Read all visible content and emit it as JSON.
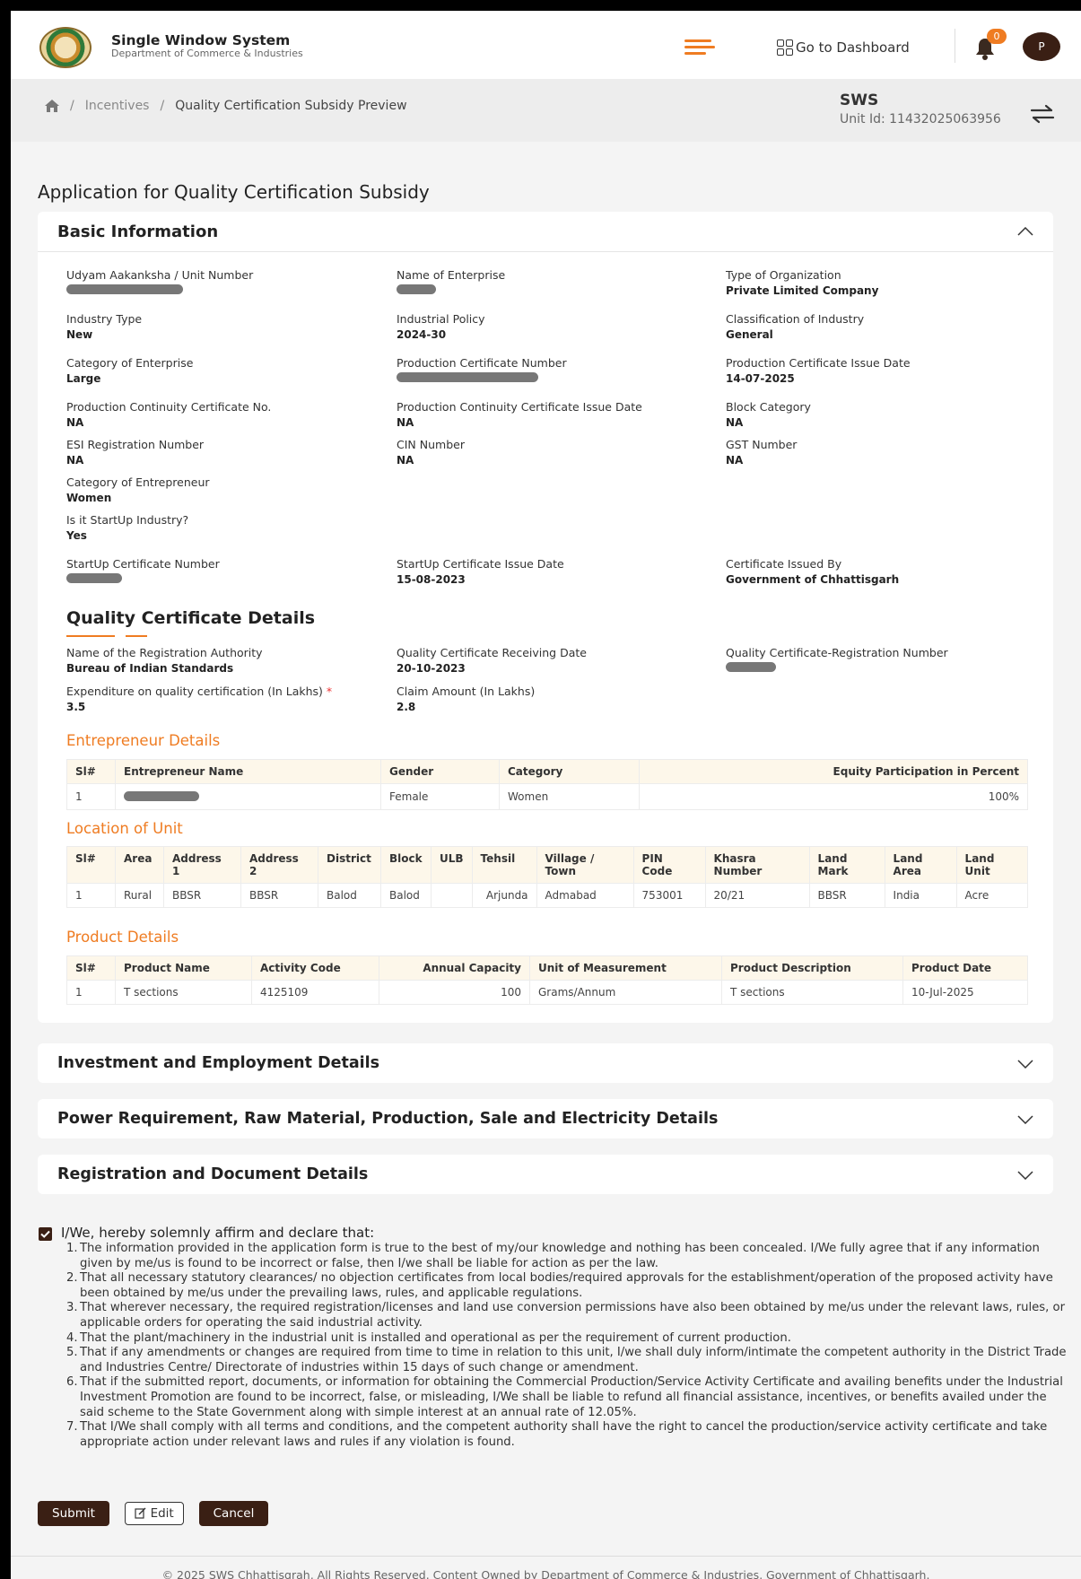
{
  "header": {
    "brand_title": "Single Window System",
    "brand_subtitle": "Department of Commerce & Industries",
    "dashboard_label": "Go to Dashboard",
    "notification_count": "0",
    "avatar_initial": "P"
  },
  "breadcrumb": {
    "items": [
      "Incentives",
      "Quality Certification Subsidy Preview"
    ],
    "separator": "/"
  },
  "unit": {
    "title": "SWS",
    "id_text": "Unit Id: 11432025063956"
  },
  "page_title": "Application for Quality Certification Subsidy",
  "basic_info": {
    "heading": "Basic Information",
    "fields": {
      "udyam_label": "Udyam Aakanksha / Unit Number",
      "enterprise_name_label": "Name of Enterprise",
      "org_type_label": "Type of Organization",
      "org_type_value": "Private Limited Company",
      "industry_type_label": "Industry Type",
      "industry_type_value": "New",
      "policy_label": "Industrial Policy",
      "policy_value": "2024-30",
      "classification_label": "Classification of Industry",
      "classification_value": "General",
      "category_label": "Category of Enterprise",
      "category_value": "Large",
      "prod_cert_no_label": "Production Certificate Number",
      "prod_cert_date_label": "Production Certificate Issue Date",
      "prod_cert_date_value": "14-07-2025",
      "cont_cert_no_label": "Production Continuity Certificate No.",
      "cont_cert_no_value": "NA",
      "cont_cert_date_label": "Production Continuity Certificate Issue Date",
      "cont_cert_date_value": "NA",
      "block_cat_label": "Block Category",
      "block_cat_value": "NA",
      "esi_label": "ESI Registration Number",
      "esi_value": "NA",
      "cin_label": "CIN Number",
      "cin_value": "NA",
      "gst_label": "GST Number",
      "gst_value": "NA",
      "entrepreneur_cat_label": "Category of Entrepreneur",
      "entrepreneur_cat_value": "Women",
      "startup_label": "Is it StartUp Industry?",
      "startup_value": "Yes",
      "startup_cert_no_label": "StartUp Certificate Number",
      "startup_cert_date_label": "StartUp Certificate Issue Date",
      "startup_cert_date_value": "15-08-2023",
      "cert_issued_by_label": "Certificate Issued By",
      "cert_issued_by_value": "Government of Chhattisgarh"
    }
  },
  "quality_cert": {
    "heading": "Quality Certificate Details",
    "authority_label": "Name of the Registration Authority",
    "authority_value": "Bureau of Indian Standards",
    "receiving_date_label": "Quality Certificate Receiving Date",
    "receiving_date_value": "20-10-2023",
    "reg_number_label": "Quality Certificate-Registration Number",
    "expenditure_label": "Expenditure on quality certification (In Lakhs)",
    "expenditure_required": "*",
    "expenditure_value": "3.5",
    "claim_label": "Claim Amount (In Lakhs)",
    "claim_value": "2.8"
  },
  "entrepreneur_details": {
    "title": "Entrepreneur Details",
    "headers": [
      "Sl#",
      "Entrepreneur Name",
      "Gender",
      "Category",
      "Equity Participation in Percent"
    ],
    "rows": [
      {
        "sl": "1",
        "gender": "Female",
        "category": "Women",
        "equity": "100%"
      }
    ]
  },
  "location_details": {
    "title": "Location of Unit",
    "headers": [
      "Sl#",
      "Area",
      "Address 1",
      "Address 2",
      "District",
      "Block",
      "ULB",
      "Tehsil",
      "Village / Town",
      "PIN Code",
      "Khasra Number",
      "Land Mark",
      "Land Area",
      "Land Unit"
    ],
    "rows": [
      [
        "1",
        "Rural",
        "BBSR",
        "BBSR",
        "Balod",
        "Balod",
        "",
        "Arjunda",
        "Admabad",
        "753001",
        "20/21",
        "BBSR",
        "India",
        "Acre"
      ]
    ]
  },
  "product_details": {
    "title": "Product Details",
    "headers": [
      "Sl#",
      "Product Name",
      "Activity Code",
      "Annual Capacity",
      "Unit of Measurement",
      "Product Description",
      "Product Date"
    ],
    "rows": [
      [
        "1",
        "T sections",
        "4125109",
        "100",
        "Grams/Annum",
        "T sections",
        "10-Jul-2025"
      ]
    ]
  },
  "accordions": [
    "Investment and Employment Details",
    "Power Requirement, Raw Material, Production, Sale and Electricity Details",
    "Registration and Document Details"
  ],
  "declaration": {
    "checked": true,
    "title": "I/We, hereby solemnly affirm and declare that:",
    "items": [
      "The information provided in the application form is true to the best of my/our knowledge and nothing has been concealed. I/We fully agree that if any information given by me/us is found to be incorrect or false, then I/we shall be liable for action as per the law.",
      "That all necessary statutory clearances/ no objection certificates from local bodies/required approvals for the establishment/operation of the proposed activity have been obtained by me/us under the prevailing laws, rules, and applicable regulations.",
      "That wherever necessary, the required registration/licenses and land use conversion permissions have also been obtained by me/us under the relevant laws, rules, or applicable orders for operating the said industrial activity.",
      "That the plant/machinery in the industrial unit is installed and operational as per the requirement of current production.",
      "That if any amendments or changes are required from time to time in relation to this unit, I/we shall duly inform/intimate the competent authority in the District Trade and Industries Centre/ Directorate of industries within 15 days of such change or amendment.",
      "That if the submitted report, documents, or information for obtaining the Commercial Production/Service Activity Certificate and availing benefits under the Industrial Investment Promotion are found to be incorrect, false, or misleading, I/We shall be liable to refund all financial assistance, incentives, or benefits availed under the said scheme to the State Government along with simple interest at an annual rate of 12.05%.",
      "That I/We shall comply with all terms and conditions, and the competent authority shall have the right to cancel the production/service activity certificate and take appropriate action under relevant laws and rules if any violation is found."
    ]
  },
  "actions": {
    "submit": "Submit",
    "edit": "Edit",
    "cancel": "Cancel"
  },
  "footer": "© 2025 SWS Chhattisgrah, All Rights Reserved. Content Owned by Department of Commerce & Industries, Government of Chhattisgarh.",
  "colors": {
    "accent": "#ef7c22",
    "primary_dark": "#3a1f14",
    "table_header_bg": "#fdf7ea"
  }
}
